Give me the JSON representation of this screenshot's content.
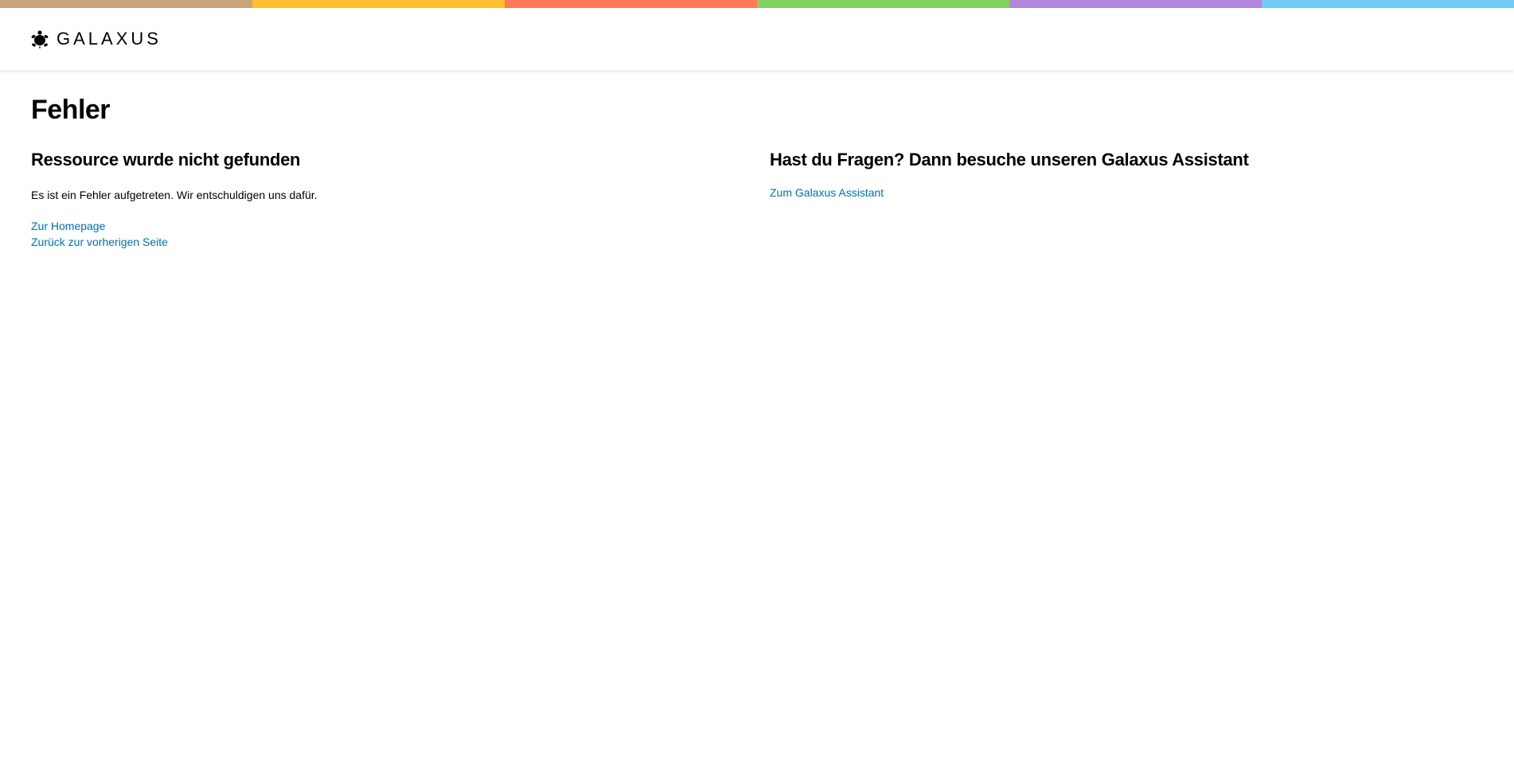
{
  "colors": {
    "bar_segments": [
      "#c9a57c",
      "#ffc12f",
      "#ff7a5a",
      "#84d163",
      "#b387dc",
      "#72caf9"
    ],
    "link": "#0070b8"
  },
  "header": {
    "logo_icon": "galaxus-turtle-icon",
    "logo_text": "GALAXUS"
  },
  "main": {
    "title": "Fehler",
    "left": {
      "heading": "Ressource wurde nicht gefunden",
      "message": "Es ist ein Fehler aufgetreten. Wir entschuldigen uns dafür.",
      "links": [
        {
          "label": "Zur Homepage"
        },
        {
          "label": "Zurück zur vorherigen Seite"
        }
      ]
    },
    "right": {
      "heading": "Hast du Fragen? Dann besuche unseren Galaxus Assistant",
      "link": {
        "label": "Zum Galaxus Assistant"
      }
    }
  }
}
